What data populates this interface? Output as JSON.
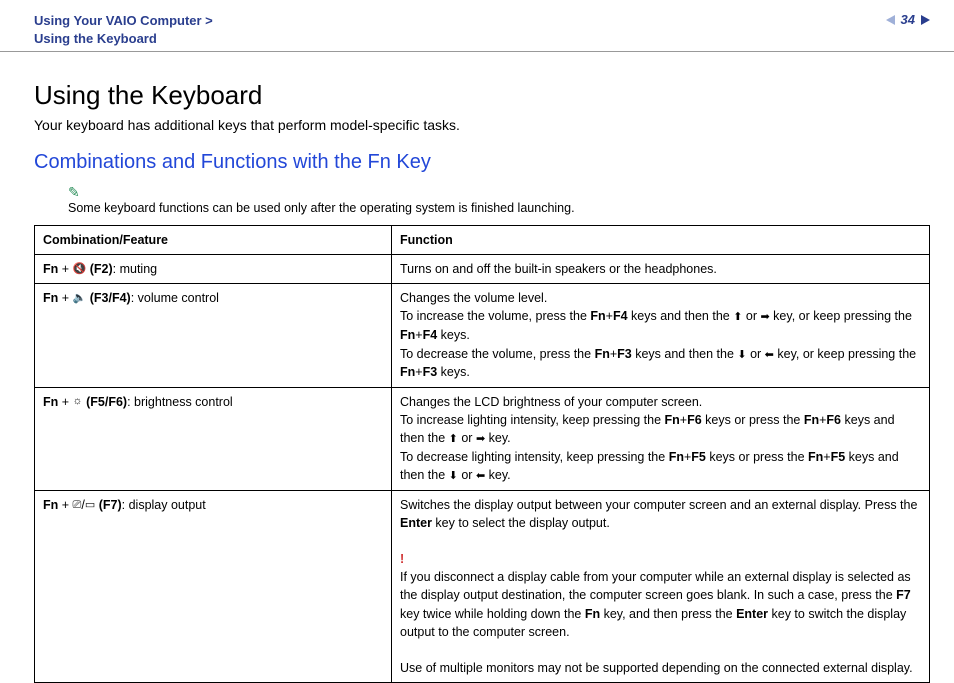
{
  "header": {
    "breadcrumb_line1": "Using Your VAIO Computer >",
    "breadcrumb_line2": "Using the Keyboard",
    "page_number": "34"
  },
  "title": "Using the Keyboard",
  "intro": "Your keyboard has additional keys that perform model-specific tasks.",
  "section_title": "Combinations and Functions with the Fn Key",
  "note": "Some keyboard functions can be used only after the operating system is finished launching.",
  "table": {
    "head_combo": "Combination/Feature",
    "head_func": "Function",
    "rows": [
      {
        "combo_prefix": "Fn",
        "combo_plus": " + ",
        "combo_key": "(F2)",
        "combo_label": ": muting",
        "icon": "🔇",
        "func_plain": "Turns on and off the built-in speakers or the headphones."
      },
      {
        "combo_prefix": "Fn",
        "combo_plus": " + ",
        "combo_key": "(F3/F4)",
        "combo_label": ": volume control",
        "icon": "🔈",
        "func_l1": "Changes the volume level.",
        "func_l2a": "To increase the volume, press the ",
        "func_l2b": "Fn",
        "func_l2c": "+",
        "func_l2d": "F4",
        "func_l2e": " keys and then the ",
        "func_l2f": " or ",
        "func_l2g": " key, or keep pressing the ",
        "func_l2h": "Fn",
        "func_l2i": "+",
        "func_l2j": "F4",
        "func_l2k": " keys.",
        "func_l3a": "To decrease the volume, press the ",
        "func_l3b": "Fn",
        "func_l3c": "+",
        "func_l3d": "F3",
        "func_l3e": " keys and then the ",
        "func_l3f": " or ",
        "func_l3g": " key, or keep pressing the ",
        "func_l3h": "Fn",
        "func_l3i": "+",
        "func_l3j": "F3",
        "func_l3k": " keys."
      },
      {
        "combo_prefix": "Fn",
        "combo_plus": " + ",
        "combo_key": "(F5/F6)",
        "combo_label": ": brightness control",
        "icon": "☼",
        "func_l1": "Changes the LCD brightness of your computer screen.",
        "func_l2a": "To increase lighting intensity, keep pressing the ",
        "func_l2b": "Fn",
        "func_l2c": "+",
        "func_l2d": "F6",
        "func_l2e": " keys or press the ",
        "func_l2f": "Fn",
        "func_l2g": "+",
        "func_l2h": "F6",
        "func_l2i": " keys and then the ",
        "func_l2j": " or ",
        "func_l2k": " key.",
        "func_l3a": "To decrease lighting intensity, keep pressing the ",
        "func_l3b": "Fn",
        "func_l3c": "+",
        "func_l3d": "F5",
        "func_l3e": " keys or press the ",
        "func_l3f": "Fn",
        "func_l3g": "+",
        "func_l3h": "F5",
        "func_l3i": " keys and then the ",
        "func_l3j": " or ",
        "func_l3k": " key."
      },
      {
        "combo_prefix": "Fn",
        "combo_plus": " + ",
        "combo_key": "(F7)",
        "combo_label": ": display output",
        "icon1": "⎚",
        "icon_sep": "/",
        "icon2": "▭",
        "func_l1a": "Switches the display output between your computer screen and an external display. Press the ",
        "func_l1b": "Enter",
        "func_l1c": " key to select the display output.",
        "warn": "!",
        "func_l2a": "If you disconnect a display cable from your computer while an external display is selected as the display output destination, the computer screen goes blank. In such a case, press the ",
        "func_l2b": "F7",
        "func_l2c": " key twice while holding down the ",
        "func_l2d": "Fn",
        "func_l2e": " key, and then press the ",
        "func_l2f": "Enter",
        "func_l2g": " key to switch the display output to the computer screen.",
        "func_l3": "Use of multiple monitors may not be supported depending on the connected external display."
      }
    ]
  }
}
